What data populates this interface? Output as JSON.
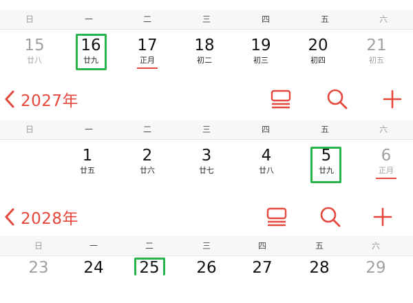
{
  "week_labels": [
    "日",
    "一",
    "二",
    "三",
    "四",
    "五",
    "六"
  ],
  "colors": {
    "accent": "#e5473c",
    "selection": "#28b44a"
  },
  "icons": {
    "back": "chevron-left-icon",
    "list": "list-view-icon",
    "search": "search-icon",
    "add": "plus-icon"
  },
  "section_top": {
    "days": [
      {
        "num": "15",
        "lunar": "廿八"
      },
      {
        "num": "16",
        "lunar": "廿九"
      },
      {
        "num": "17",
        "lunar": "正月"
      },
      {
        "num": "18",
        "lunar": "初二"
      },
      {
        "num": "19",
        "lunar": "初三"
      },
      {
        "num": "20",
        "lunar": "初四"
      },
      {
        "num": "21",
        "lunar": "初五"
      }
    ]
  },
  "section_2027": {
    "year": "2027年",
    "days": [
      {
        "num": "1",
        "lunar": "廿五"
      },
      {
        "num": "2",
        "lunar": "廿六"
      },
      {
        "num": "3",
        "lunar": "廿七"
      },
      {
        "num": "4",
        "lunar": "廿八"
      },
      {
        "num": "5",
        "lunar": "廿九"
      },
      {
        "num": "6",
        "lunar": "正月"
      }
    ]
  },
  "section_2028": {
    "year": "2028年",
    "days": [
      {
        "num": "23"
      },
      {
        "num": "24"
      },
      {
        "num": "25"
      },
      {
        "num": "26"
      },
      {
        "num": "27"
      },
      {
        "num": "28"
      },
      {
        "num": "29"
      }
    ]
  }
}
